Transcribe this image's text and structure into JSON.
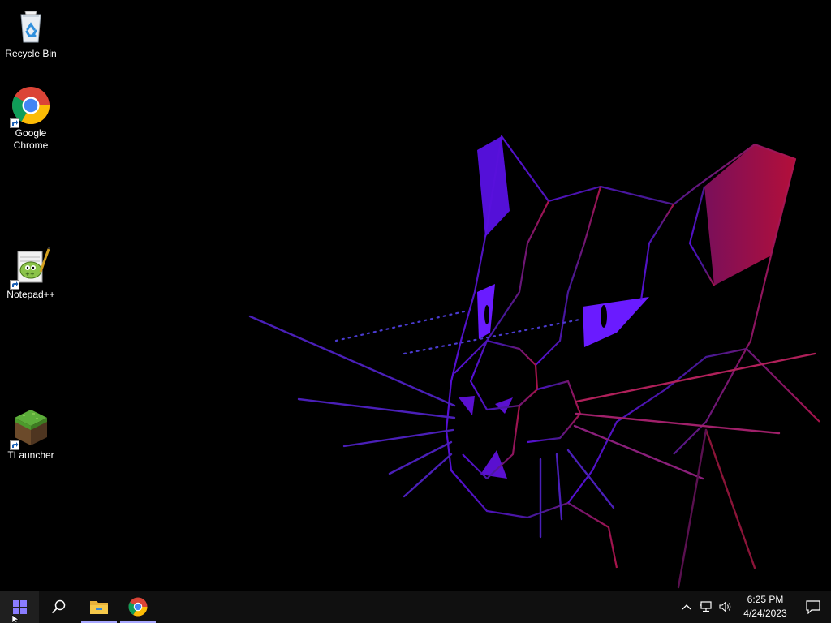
{
  "desktop": {
    "icons": [
      {
        "label": "Recycle Bin",
        "icon": "recycle-bin-icon",
        "shortcut": false
      },
      {
        "label": "Google\nChrome",
        "icon": "chrome-icon",
        "shortcut": true
      },
      {
        "label": "Notepad++",
        "icon": "notepad-plus-plus-icon",
        "shortcut": true
      },
      {
        "label": "TLauncher",
        "icon": "tlauncher-icon",
        "shortcut": true
      }
    ]
  },
  "taskbar": {
    "start": {
      "icon": "windows-logo-icon"
    },
    "search": {
      "icon": "search-icon"
    },
    "pinned": [
      {
        "name": "File Explorer",
        "icon": "folder-icon",
        "running": true
      },
      {
        "name": "Google Chrome",
        "icon": "chrome-icon",
        "running": true
      }
    ],
    "tray": {
      "icons": [
        "chevron-up-icon",
        "network-icon",
        "volume-icon"
      ],
      "time": "6:25 PM",
      "date": "4/24/2023",
      "notifications_icon": "action-center-icon"
    }
  },
  "colors": {
    "accent_purple": "#6a1bff",
    "accent_magenta": "#c0185a",
    "taskbar": "#101010",
    "running_indicator": "#a8a8ff"
  }
}
